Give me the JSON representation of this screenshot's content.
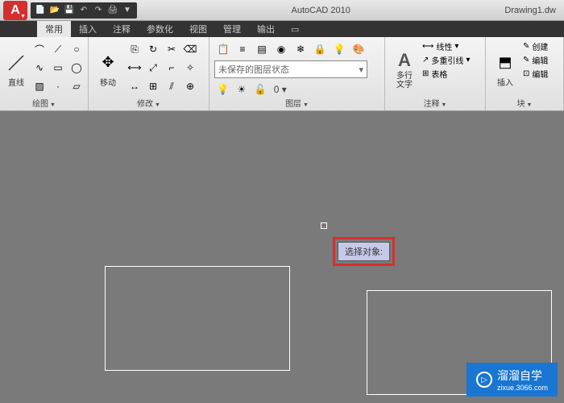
{
  "app": {
    "title": "AutoCAD 2010",
    "filename": "Drawing1.dw"
  },
  "qat": [
    "new",
    "open",
    "save",
    "undo",
    "redo",
    "print"
  ],
  "tabs": [
    {
      "label": "常用",
      "active": true
    },
    {
      "label": "插入",
      "active": false
    },
    {
      "label": "注释",
      "active": false
    },
    {
      "label": "参数化",
      "active": false
    },
    {
      "label": "视图",
      "active": false
    },
    {
      "label": "管理",
      "active": false
    },
    {
      "label": "输出",
      "active": false
    }
  ],
  "panels": {
    "draw": {
      "title": "绘图",
      "line_label": "直线"
    },
    "modify": {
      "title": "修改",
      "move_label": "移动"
    },
    "layers": {
      "title": "图层",
      "state": "未保存的图层状态"
    },
    "annotation": {
      "title": "注释",
      "text_label": "多行\n文字",
      "items": [
        "线性",
        "多重引线",
        "表格"
      ]
    },
    "block": {
      "title": "块",
      "insert_label": "插入",
      "items": [
        "创建",
        "编辑",
        "编辑"
      ]
    }
  },
  "tooltip": "选择对象:",
  "watermark": {
    "main": "溜溜自学",
    "sub": "zixue.3066.com"
  }
}
